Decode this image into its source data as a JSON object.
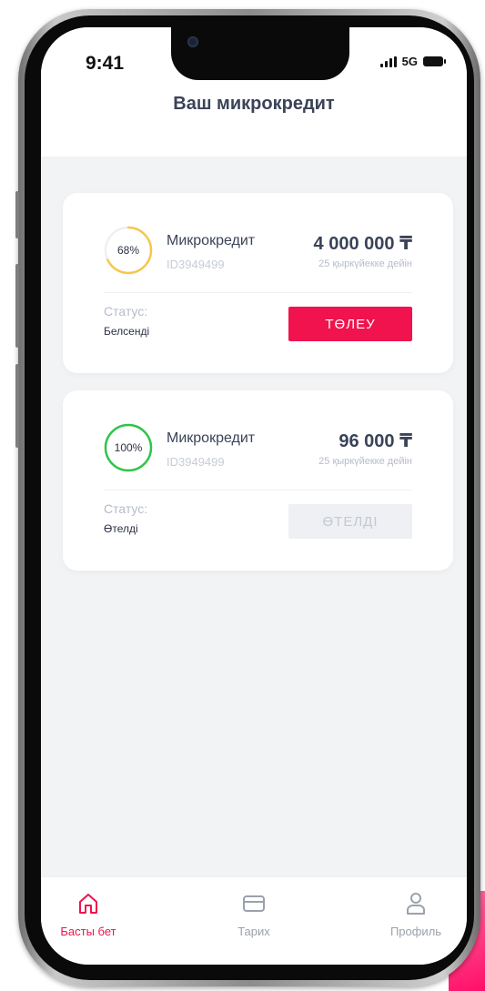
{
  "status_bar": {
    "time": "9:41",
    "network": "5G"
  },
  "header": {
    "title": "Ваш микрокредит"
  },
  "loans": [
    {
      "progress_label": "68%",
      "progress": 0.68,
      "progress_color": "#f5c84c",
      "title": "Микрокредит",
      "id": "ID3949499",
      "amount": "4 000 000 ₸",
      "due": "25 қыркүйекке дейін",
      "status_label": "Статус:",
      "status_value": "Белсенді",
      "button_label": "ТӨЛЕУ",
      "button_state": "active"
    },
    {
      "progress_label": "100%",
      "progress": 1.0,
      "progress_color": "#2fc44a",
      "title": "Микрокредит",
      "id": "ID3949499",
      "amount": "96 000 ₸",
      "due": "25 қыркүйекке дейін",
      "status_label": "Статус:",
      "status_value": "Өтелді",
      "button_label": "ӨТЕЛДІ",
      "button_state": "disabled"
    }
  ],
  "tabs": [
    {
      "label": "Басты бет",
      "icon": "home-icon",
      "active": true
    },
    {
      "label": "Тарих",
      "icon": "card-icon",
      "active": false
    },
    {
      "label": "Профиль",
      "icon": "profile-icon",
      "active": false
    }
  ],
  "colors": {
    "accent": "#f0134d",
    "text_dark": "#3a4358",
    "muted": "#b6bcc8"
  }
}
